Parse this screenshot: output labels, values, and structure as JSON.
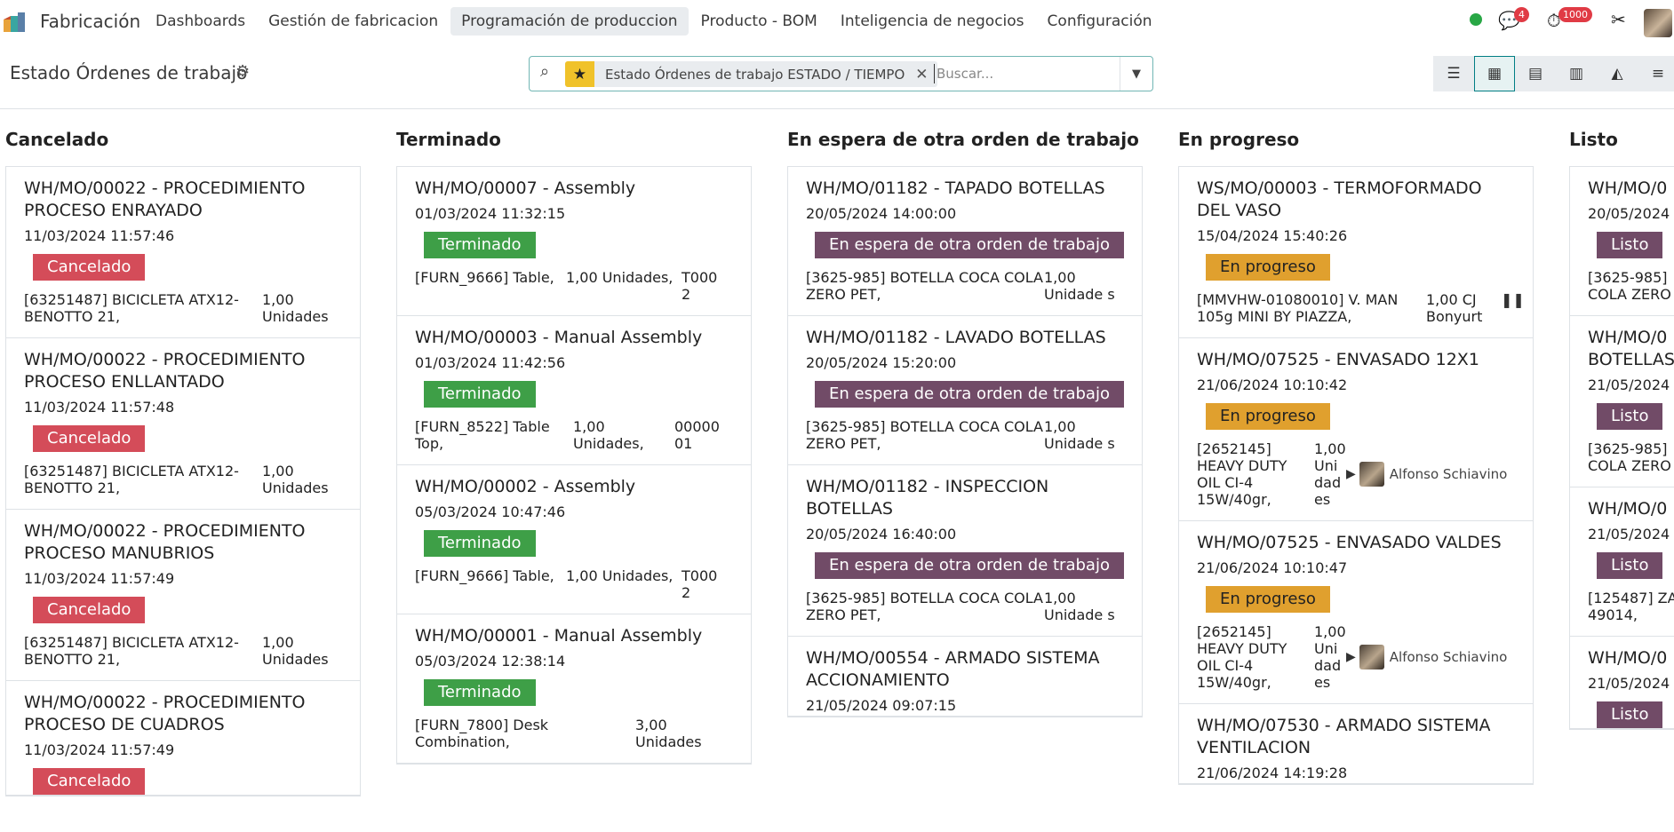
{
  "app": {
    "name": "Fabricación",
    "menu": [
      "Dashboards",
      "Gestión de fabricacion",
      "Programación de produccion",
      "Producto - BOM",
      "Inteligencia de negocios",
      "Configuración"
    ],
    "active_menu": "Programación de produccion",
    "messages_count": "4",
    "activities_count": "1000"
  },
  "control": {
    "title": "Estado Órdenes de trabajo",
    "facet": "Estado Órdenes de trabajo ESTADO / TIEMPO",
    "search_placeholder": "Buscar..."
  },
  "columns": [
    {
      "title": "Cancelado",
      "cards": [
        {
          "title": "WH/MO/00022 - PROCEDIMIENTO PROCESO ENRAYADO",
          "date": "11/03/2024 11:57:46",
          "status": "Cancelado",
          "product": "[63251487] BICICLETA ATX12-BENOTTO 21,",
          "qty": "1,00 Unidades"
        },
        {
          "title": "WH/MO/00022 - PROCEDIMIENTO PROCESO ENLLANTADO",
          "date": "11/03/2024 11:57:48",
          "status": "Cancelado",
          "product": "[63251487] BICICLETA ATX12-BENOTTO 21,",
          "qty": "1,00 Unidades"
        },
        {
          "title": "WH/MO/00022 - PROCEDIMIENTO PROCESO MANUBRIOS",
          "date": "11/03/2024 11:57:49",
          "status": "Cancelado",
          "product": "[63251487] BICICLETA ATX12-BENOTTO 21,",
          "qty": "1,00 Unidades"
        },
        {
          "title": "WH/MO/00022 - PROCEDIMIENTO PROCESO DE CUADROS",
          "date": "11/03/2024 11:57:49",
          "status": "Cancelado"
        }
      ]
    },
    {
      "title": "Terminado",
      "cards": [
        {
          "title": "WH/MO/00007 - Assembly",
          "date": "01/03/2024 11:32:15",
          "status": "Terminado",
          "product": "[FURN_9666] Table,",
          "qty": "1,00 Unidades,",
          "ref": "T000 2"
        },
        {
          "title": "WH/MO/00003 - Manual Assembly",
          "date": "01/03/2024 11:42:56",
          "status": "Terminado",
          "product": "[FURN_8522] Table Top,",
          "qty": "1,00 Unidades,",
          "ref": "00000 01"
        },
        {
          "title": "WH/MO/00002 - Assembly",
          "date": "05/03/2024 10:47:46",
          "status": "Terminado",
          "product": "[FURN_9666] Table,",
          "qty": "1,00 Unidades,",
          "ref": "T000 2"
        },
        {
          "title": "WH/MO/00001 - Manual Assembly",
          "date": "05/03/2024 12:38:14",
          "status": "Terminado",
          "product": "[FURN_7800] Desk Combination,",
          "qty": "3,00 Unidades"
        }
      ]
    },
    {
      "title": "En espera de otra orden de trabajo",
      "cards": [
        {
          "title": "WH/MO/01182 - TAPADO BOTELLAS",
          "date": "20/05/2024 14:00:00",
          "status": "En espera de otra orden de trabajo",
          "product": "[3625-985] BOTELLA COCA COLA ZERO PET,",
          "qty": "1,00 Unidade s"
        },
        {
          "title": "WH/MO/01182 - LAVADO BOTELLAS",
          "date": "20/05/2024 15:20:00",
          "status": "En espera de otra orden de trabajo",
          "product": "[3625-985] BOTELLA COCA COLA ZERO PET,",
          "qty": "1,00 Unidade s"
        },
        {
          "title": "WH/MO/01182 - INSPECCION BOTELLAS",
          "date": "20/05/2024 16:40:00",
          "status": "En espera de otra orden de trabajo",
          "product": "[3625-985] BOTELLA COCA COLA ZERO PET,",
          "qty": "1,00 Unidade s"
        },
        {
          "title": "WH/MO/00554 - ARMADO SISTEMA ACCIONAMIENTO",
          "date": "21/05/2024 09:07:15"
        }
      ]
    },
    {
      "title": "En progreso",
      "cards": [
        {
          "title": "WS/MO/00003 - TERMOFORMADO DEL VASO",
          "date": "15/04/2024 15:40:26",
          "status": "En progreso",
          "product": "[MMVHW-01080010] V. MAN 105g MINI BY PIAZZA,",
          "qty": "1,00 CJ Bonyurt"
        },
        {
          "title": "WH/MO/07525 - ENVASADO 12X1",
          "date": "21/06/2024 10:10:42",
          "status": "En progreso",
          "product": "[2652145] HEAVY DUTY OIL CI-4 15W/40gr,",
          "qty": "1,00 Uni dad es",
          "worker": "Alfonso Schiavino"
        },
        {
          "title": "WH/MO/07525 - ENVASADO VALDES",
          "date": "21/06/2024 10:10:47",
          "status": "En progreso",
          "product": "[2652145] HEAVY DUTY OIL CI-4 15W/40gr,",
          "qty": "1,00 Uni dad es",
          "worker": "Alfonso Schiavino"
        },
        {
          "title": "WH/MO/07530 - ARMADO SISTEMA VENTILACION",
          "date": "21/06/2024 14:19:28"
        }
      ]
    },
    {
      "title": "Listo",
      "cards": [
        {
          "title": "WH/MO/0",
          "date": "20/05/2024",
          "status": "Listo",
          "product": "[3625-985] COLA ZERO"
        },
        {
          "title": "WH/MO/0 BOTELLAS",
          "date": "21/05/2024",
          "status": "Listo",
          "product": "[3625-985] COLA ZERO"
        },
        {
          "title": "WH/MO/0",
          "date": "21/05/2024",
          "status": "Listo",
          "product": "[125487] ZA 49014,"
        },
        {
          "title": "WH/MO/0",
          "date": "21/05/2024",
          "status": "Listo"
        }
      ]
    }
  ]
}
